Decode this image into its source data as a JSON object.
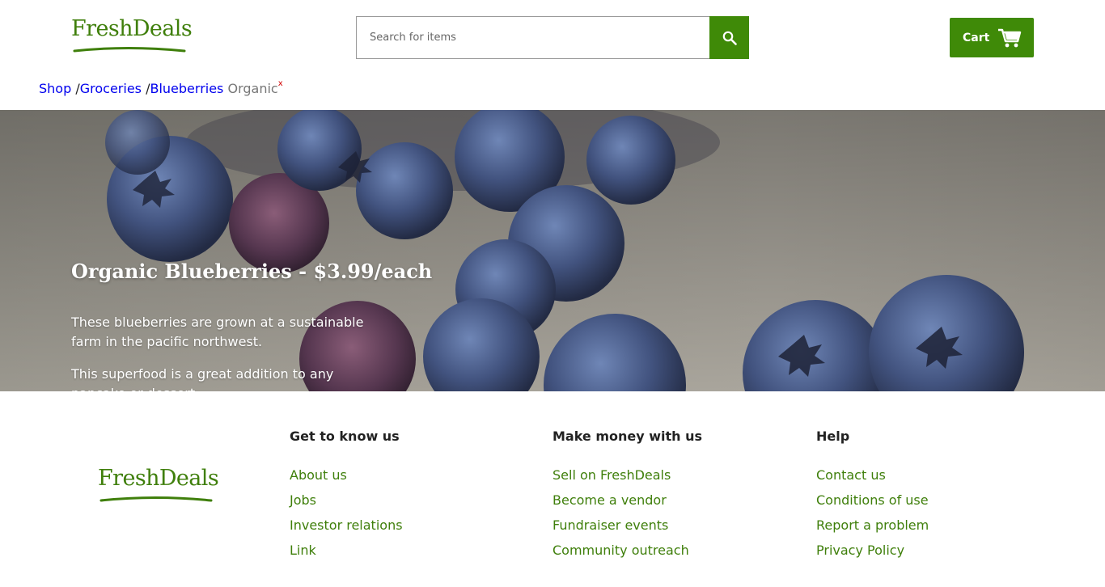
{
  "brand": {
    "name": "FreshDeals",
    "color": "#3f7f0b"
  },
  "search": {
    "placeholder": "Search for items",
    "button_icon": "search-icon"
  },
  "cart": {
    "label": "Cart",
    "icon": "cart-icon"
  },
  "breadcrumb": {
    "items": [
      {
        "label": "Shop",
        "separator": ""
      },
      {
        "label": "Groceries",
        "separator": "/"
      },
      {
        "label": "Blueberries",
        "separator": "/"
      }
    ],
    "current": "Organic",
    "remove_label": "x"
  },
  "hero": {
    "title": "Organic Blueberries - $3.99/each",
    "description": "These blueberries are grown at a sustainable farm in the pacific northwest.",
    "description2": "This superfood is a great addition to any pancake or dessert"
  },
  "footer": {
    "columns": [
      {
        "heading": "Get to know us",
        "links": [
          "About us",
          "Jobs",
          "Investor relations",
          "Link"
        ]
      },
      {
        "heading": "Make money with us",
        "links": [
          "Sell on FreshDeals",
          "Become a vendor",
          "Fundraiser events",
          "Community outreach"
        ]
      },
      {
        "heading": "Help",
        "links": [
          "Contact us",
          "Conditions of use",
          "Report a problem",
          "Privacy Policy"
        ]
      }
    ]
  },
  "colors": {
    "accent": "#3f8a08",
    "link": "#0000ee",
    "remove": "#d20000"
  }
}
